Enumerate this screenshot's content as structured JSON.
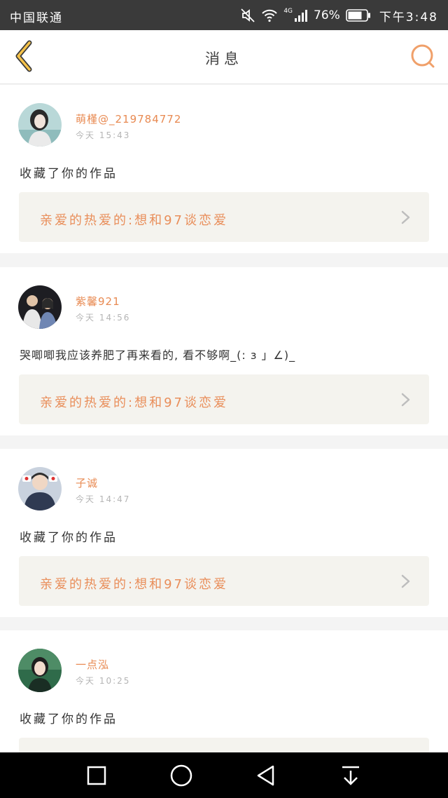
{
  "status_bar": {
    "carrier": "中国联通",
    "network": "4G",
    "battery": "76%",
    "time": "下午3:48"
  },
  "header": {
    "title": "消息"
  },
  "messages": [
    {
      "username": "萌槿@_219784772",
      "time": "今天 15:43",
      "text": "收藏了你的作品",
      "work_title": "亲爱的热爱的:想和97谈恋爱"
    },
    {
      "username": "紫馨921",
      "time": "今天 14:56",
      "text": "哭唧唧我应该养肥了再来看的, 看不够啊_(: з 」∠)_",
      "work_title": "亲爱的热爱的:想和97谈恋爱"
    },
    {
      "username": "子诚",
      "time": "今天 14:47",
      "text": "收藏了你的作品",
      "work_title": "亲爱的热爱的:想和97谈恋爱"
    },
    {
      "username": "一点泓",
      "time": "今天 10:25",
      "text": "收藏了你的作品",
      "work_title": ""
    }
  ],
  "icons": {
    "back": "back-chevron-icon",
    "search": "search-icon",
    "nav": [
      "recents-square-icon",
      "home-circle-icon",
      "back-triangle-icon",
      "notification-pull-icon"
    ]
  },
  "colors": {
    "accent": "#e88a52",
    "back_icon": "#f5c24a",
    "work_box": "#f4f3ee"
  }
}
